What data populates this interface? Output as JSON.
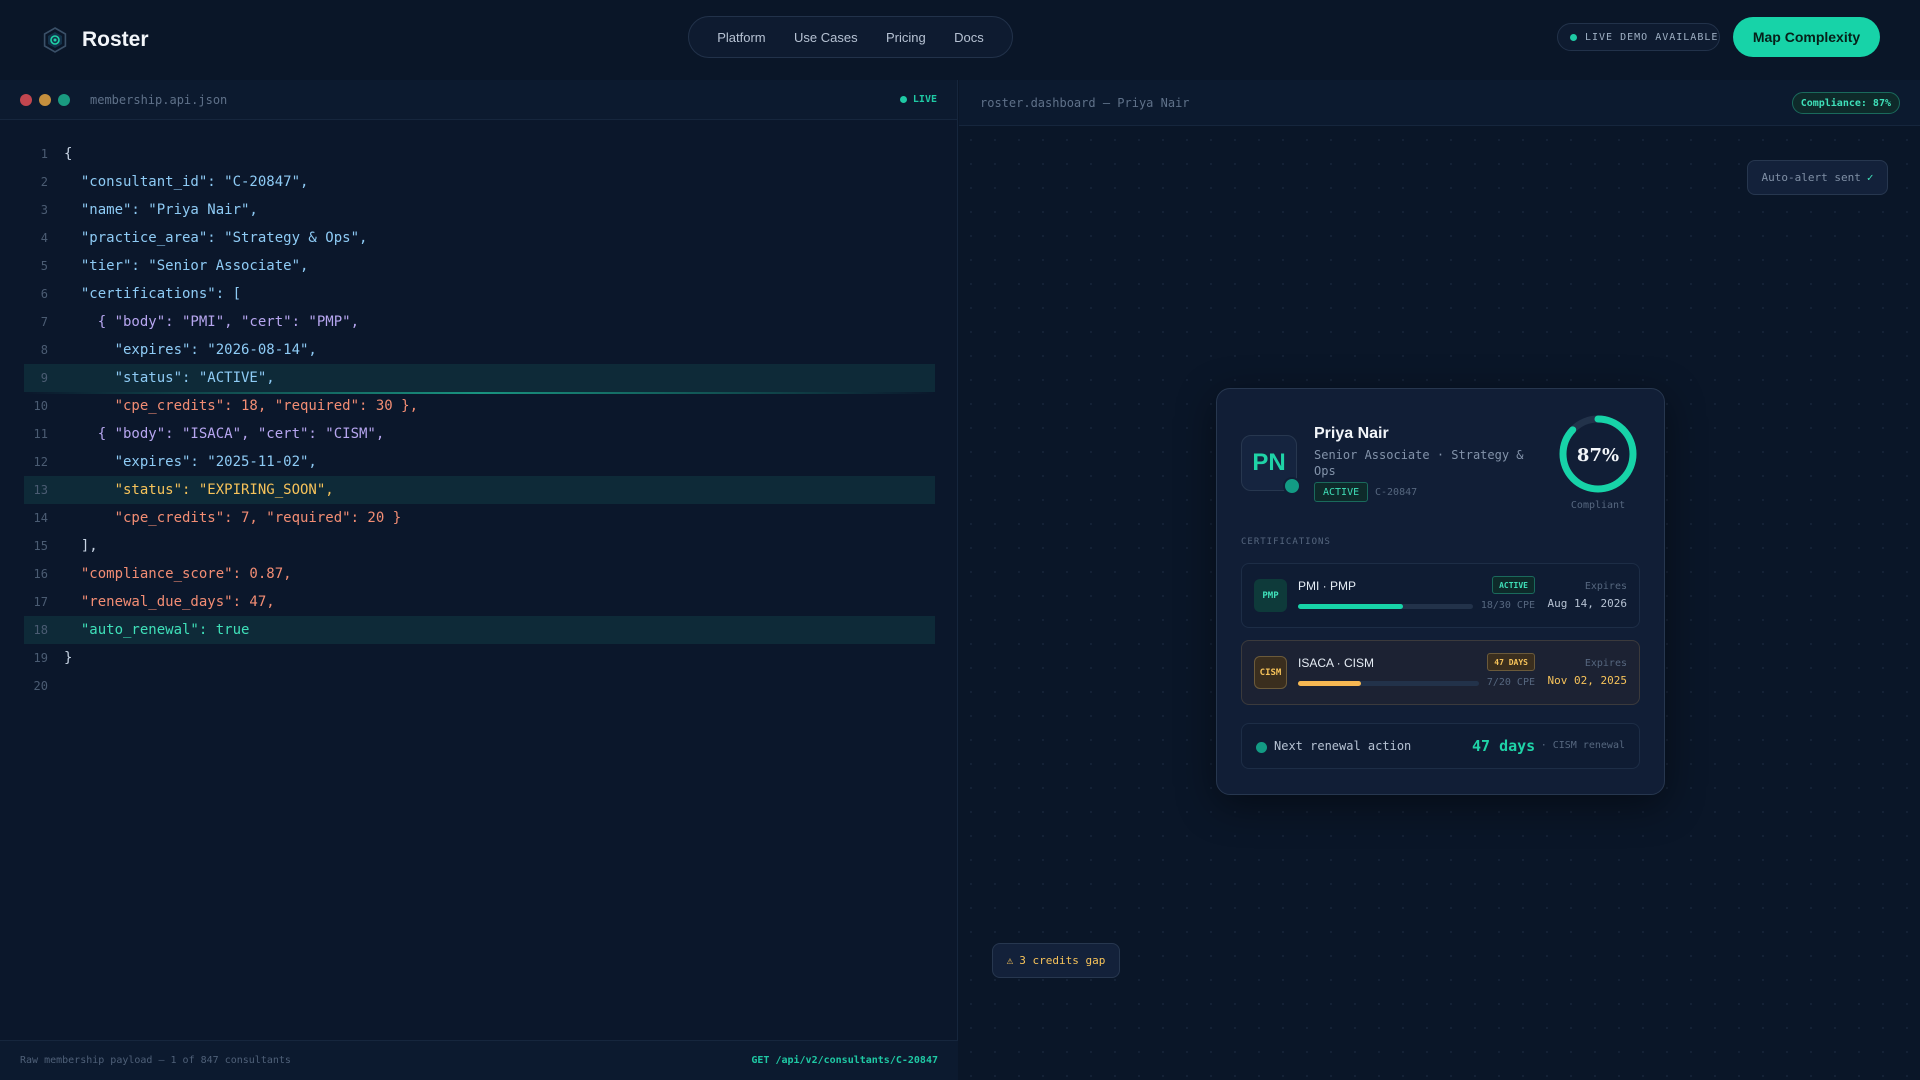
{
  "brand": {
    "name": "Roster",
    "logo_icon": "roster-logo-icon"
  },
  "nav": {
    "items": [
      "Platform",
      "Use Cases",
      "Pricing",
      "Docs"
    ]
  },
  "header": {
    "live_demo": "LIVE DEMO AVAILABLE",
    "cta_label": "Map Complexity"
  },
  "colors": {
    "accent": "#17d3a8",
    "background": "#0a1628",
    "warning": "#f7c35a",
    "danger": "#f38d74"
  },
  "code_panel": {
    "filename": "membership.api.json",
    "live_label": "LIVE",
    "lines": [
      {
        "n": "1",
        "text": "{",
        "c": "plain"
      },
      {
        "n": "2",
        "text": "  \"consultant_id\": \"C-20847\",",
        "c": "blue"
      },
      {
        "n": "3",
        "text": "  \"name\": \"Priya Nair\",",
        "c": "blue"
      },
      {
        "n": "4",
        "text": "  \"practice_area\": \"Strategy & Ops\",",
        "c": "blue"
      },
      {
        "n": "5",
        "text": "  \"tier\": \"Senior Associate\",",
        "c": "blue"
      },
      {
        "n": "6",
        "text": "  \"certifications\": [",
        "c": "blue"
      },
      {
        "n": "7",
        "text": "    { \"body\": \"PMI\", \"cert\": \"PMP\",",
        "c": "purple"
      },
      {
        "n": "8",
        "text": "      \"expires\": \"2026-08-14\",",
        "c": "blue"
      },
      {
        "n": "9",
        "text": "      \"status\": \"ACTIVE\",",
        "c": "blue",
        "hl": true
      },
      {
        "n": "10",
        "text": "      \"cpe_credits\": 18, \"required\": 30 },",
        "c": "coral"
      },
      {
        "n": "11",
        "text": "    { \"body\": \"ISACA\", \"cert\": \"CISM\",",
        "c": "purple"
      },
      {
        "n": "12",
        "text": "      \"expires\": \"2025-11-02\",",
        "c": "blue"
      },
      {
        "n": "13",
        "text": "      \"status\": \"EXPIRING_SOON\",",
        "c": "amber",
        "hl": true
      },
      {
        "n": "14",
        "text": "      \"cpe_credits\": 7, \"required\": 20 }",
        "c": "coral"
      },
      {
        "n": "15",
        "text": "  ],",
        "c": "plain"
      },
      {
        "n": "16",
        "text": "  \"compliance_score\": 0.87,",
        "c": "coral"
      },
      {
        "n": "17",
        "text": "  \"renewal_due_days\": 47,",
        "c": "coral"
      },
      {
        "n": "18",
        "text": "  \"auto_renewal\": true",
        "c": "teal",
        "hl": true
      },
      {
        "n": "19",
        "text": "}",
        "c": "plain"
      },
      {
        "n": "20",
        "text": "",
        "c": "plain"
      }
    ],
    "footer_left": "Raw membership payload — 1 of 847 consultants",
    "footer_right": "GET /api/v2/consultants/C-20847"
  },
  "dashboard": {
    "title": "roster.dashboard — Priya Nair",
    "compliance_pill": "Compliance: 87%",
    "alert_toast": "Auto-alert sent",
    "alert_check": "✓",
    "profile": {
      "initials": "PN",
      "name": "Priya Nair",
      "role": "Senior Associate · Strategy & Ops",
      "status": "ACTIVE",
      "id": "C-20847",
      "compliance_value": 0.87,
      "compliance_text": "87%",
      "compliance_label": "Compliant"
    },
    "certifications_heading": "CERTIFICATIONS",
    "certifications": [
      {
        "badge": "PMP",
        "name": "PMI · PMP",
        "status": "ACTIVE",
        "progress": 0.6,
        "cpe": "18/30 CPE",
        "expires_label": "Expires",
        "expires": "Aug 14, 2026",
        "tone": "ok"
      },
      {
        "badge": "CISM",
        "name": "ISACA · CISM",
        "status": "47 DAYS",
        "progress": 0.35,
        "cpe": "7/20 CPE",
        "expires_label": "Expires",
        "expires": "Nov 02, 2025",
        "tone": "warn"
      }
    ],
    "next_action": {
      "label": "Next renewal action",
      "days": "47 days",
      "note": "· CISM renewal"
    },
    "gap_chip": {
      "icon": "warning-icon",
      "glyph": "⚠",
      "text": "3 credits gap"
    }
  }
}
